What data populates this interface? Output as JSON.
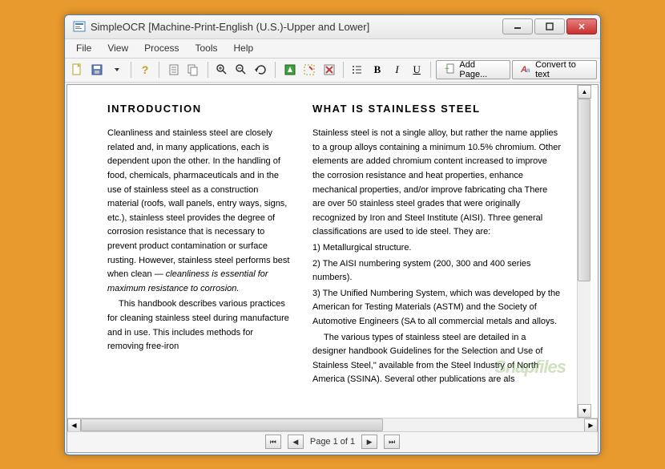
{
  "window": {
    "title": "SimpleOCR [Machine-Print-English (U.S.)-Upper and Lower]"
  },
  "menu": {
    "file": "File",
    "view": "View",
    "process": "Process",
    "tools": "Tools",
    "help": "Help"
  },
  "toolbar": {
    "add_page": "Add Page...",
    "convert": "Convert to text",
    "bold": "B",
    "italic": "I",
    "underline": "U"
  },
  "statusbar": {
    "page_label": "Page 1 of 1"
  },
  "document": {
    "col1": {
      "heading": "INTRODUCTION",
      "p1": "Cleanliness and stainless steel are closely related and, in many applications, each is dependent upon the other. In the handling of food, chemicals, pharmaceuticals and in the use of stainless steel as a construction material (roofs, wall panels, entry ways, signs, etc.), stainless steel provides the degree of corrosion resistance that is necessary to prevent product contamination or surface rusting. However, stainless steel performs best when clean —",
      "p1_italic": "cleanliness is essential for maximum resistance to corrosion.",
      "p2": "This handbook describes various practices for cleaning stainless steel during manufacture and in use. This includes methods for removing free-iron"
    },
    "col2": {
      "heading": "WHAT IS STAINLESS STEEL",
      "p1": "Stainless steel is not a single alloy, but rather the name applies to a group alloys containing a minimum 10.5% chromium. Other elements are added chromium content increased to improve the corrosion resistance and heat properties, enhance mechanical properties, and/or improve fabricating cha There are over 50 stainless steel grades that were originally recognized by Iron and Steel Institute (AISI). Three general classifications are used to ide steel. They are:",
      "li1": "1) Metallurgical structure.",
      "li2": "2) The AISI numbering system (200, 300 and 400 series numbers).",
      "li3": "3) The Unified Numbering System, which was developed by the American for Testing Materials (ASTM) and the Society of Automotive Engineers (SA to all commercial metals and alloys.",
      "p2": "The various types of stainless steel are detailed in a designer handbook Guidelines for the Selection and Use of Stainless Steel,\" available from the Steel Industry of North America (SSINA). Several other publications are als"
    }
  },
  "watermark": "Snapfiles"
}
